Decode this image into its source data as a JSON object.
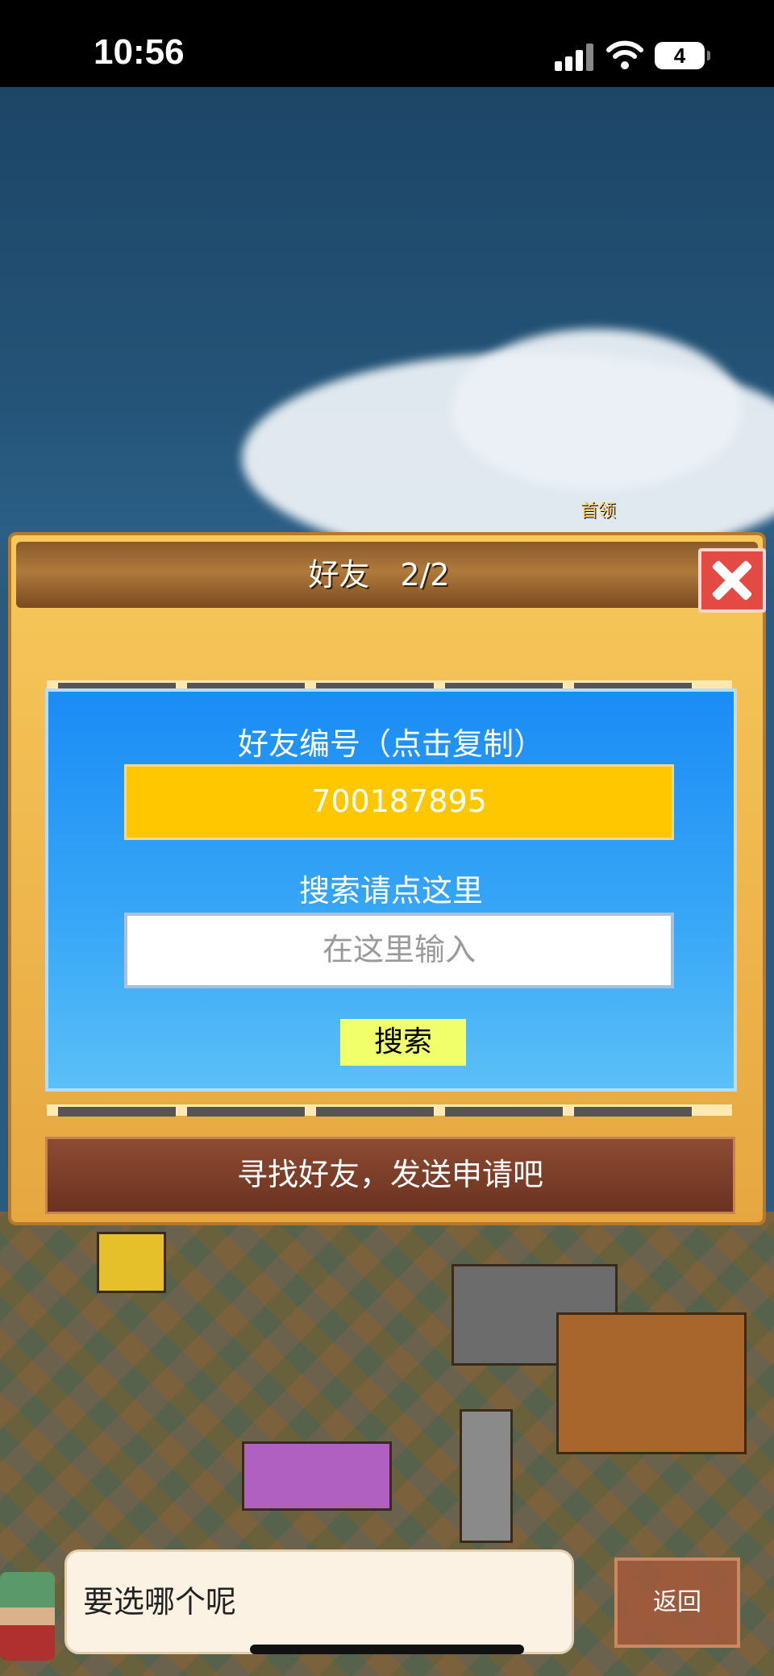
{
  "status_bar": {
    "time": "10:56",
    "battery": "4"
  },
  "scene": {
    "boss_label": "首领"
  },
  "dialog": {
    "title": "好友　2/2",
    "friend_id_label": "好友编号（点击复制）",
    "friend_id": "700187895",
    "search_label": "搜索请点这里",
    "search_placeholder": "在这里输入",
    "search_button": "搜索",
    "find_friends_button": "寻找好友，发送申请吧"
  },
  "bottom_bar": {
    "prompt": "要选哪个呢",
    "return_button": "返回"
  },
  "colors": {
    "panel_blue": "#1a8cf5",
    "id_box": "#ffc700",
    "search_button": "#f0ff6a",
    "close_button": "#e44a44",
    "find_button": "#7a3a25"
  },
  "icons": [
    "signal-icon",
    "wifi-icon",
    "battery-icon",
    "close-icon",
    "arrow-left-icon",
    "arrow-right-icon"
  ]
}
